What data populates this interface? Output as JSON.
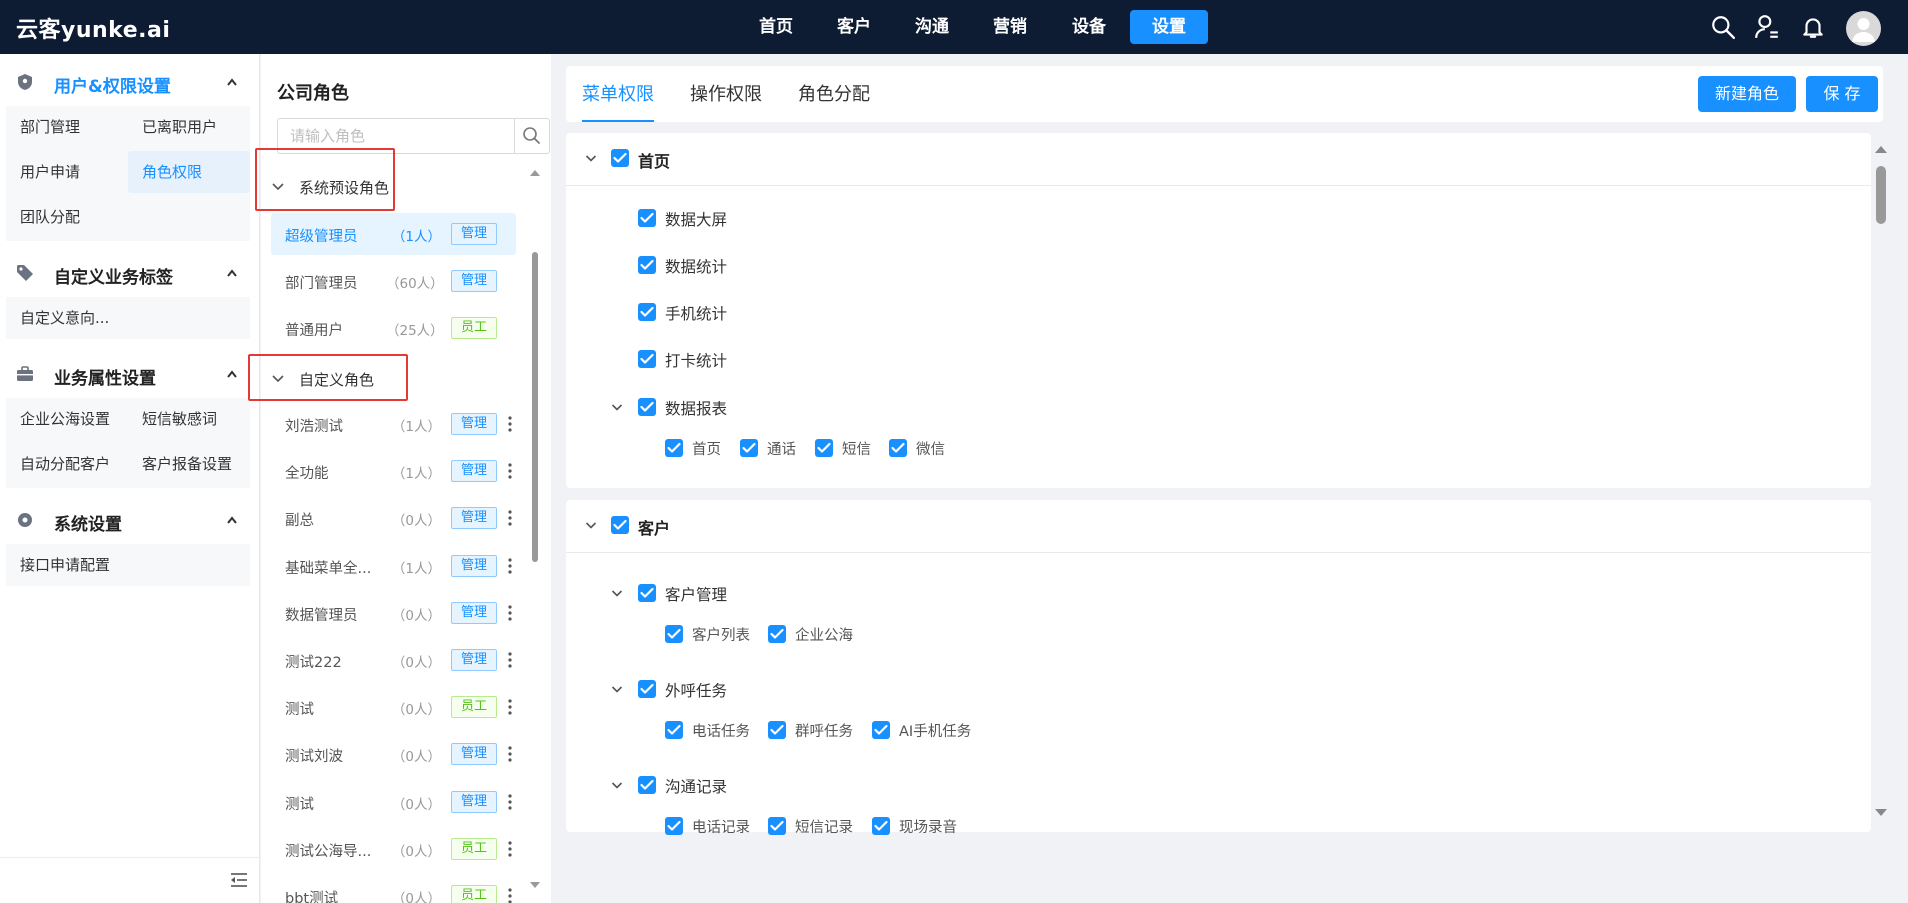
{
  "app": {
    "logo": "云客yunke.ai"
  },
  "topnav": {
    "items": [
      "首页",
      "客户",
      "沟通",
      "营销",
      "设备",
      "设置"
    ],
    "active_index": 5,
    "icons": [
      "search-icon",
      "user-settings-icon",
      "bell-icon",
      "avatar"
    ]
  },
  "sidebar": {
    "groups": [
      {
        "title": "用户&权限设置",
        "icon": "shield-icon",
        "active": true,
        "items": [
          "部门管理",
          "已离职用户",
          "用户申请",
          "角色权限",
          "团队分配"
        ],
        "active_item": "角色权限"
      },
      {
        "title": "自定义业务标签",
        "icon": "tag-icon",
        "items": [
          "自定义意向..."
        ]
      },
      {
        "title": "业务属性设置",
        "icon": "briefcase-icon",
        "items": [
          "企业公海设置",
          "短信敏感词",
          "自动分配客户",
          "客户报备设置"
        ]
      },
      {
        "title": "系统设置",
        "icon": "gear-icon",
        "items": [
          "接口申请配置"
        ]
      }
    ]
  },
  "roles": {
    "title": "公司角色",
    "search_placeholder": "请输入角色",
    "sections": [
      {
        "title": "系统预设角色",
        "items": [
          {
            "name": "超级管理员",
            "count": "（1人）",
            "tag": "管理",
            "active": true
          },
          {
            "name": "部门管理员",
            "count": "（60人）",
            "tag": "管理"
          },
          {
            "name": "普通用户",
            "count": "（25人）",
            "tag": "员工"
          }
        ]
      },
      {
        "title": "自定义角色",
        "items": [
          {
            "name": "刘浩测试",
            "count": "（1人）",
            "tag": "管理"
          },
          {
            "name": "全功能",
            "count": "（1人）",
            "tag": "管理"
          },
          {
            "name": "副总",
            "count": "（0人）",
            "tag": "管理"
          },
          {
            "name": "基础菜单全...",
            "count": "（1人）",
            "tag": "管理"
          },
          {
            "name": "数据管理员",
            "count": "（0人）",
            "tag": "管理"
          },
          {
            "name": "测试222",
            "count": "（0人）",
            "tag": "管理"
          },
          {
            "name": "测试",
            "count": "（0人）",
            "tag": "员工"
          },
          {
            "name": "测试刘波",
            "count": "（0人）",
            "tag": "管理"
          },
          {
            "name": "测试",
            "count": "（0人）",
            "tag": "管理"
          },
          {
            "name": "测试公海导...",
            "count": "（0人）",
            "tag": "员工"
          },
          {
            "name": "bbt测试",
            "count": "（0人）",
            "tag": "员工"
          }
        ]
      }
    ]
  },
  "main": {
    "tabs": [
      "菜单权限",
      "操作权限",
      "角色分配"
    ],
    "active_tab": "菜单权限",
    "buttons": {
      "new_role": "新建角色",
      "save": "保 存"
    },
    "cards": [
      {
        "title": "首页",
        "children": [
          {
            "label": "数据大屏"
          },
          {
            "label": "数据统计"
          },
          {
            "label": "手机统计"
          },
          {
            "label": "打卡统计"
          },
          {
            "label": "数据报表",
            "children": [
              "首页",
              "通话",
              "短信",
              "微信"
            ]
          }
        ]
      },
      {
        "title": "客户",
        "children": [
          {
            "label": "客户管理",
            "children": [
              "客户列表",
              "企业公海"
            ]
          },
          {
            "label": "外呼任务",
            "children": [
              "电话任务",
              "群呼任务",
              "AI手机任务"
            ]
          },
          {
            "label": "沟通记录",
            "children": [
              "电话记录",
              "短信记录",
              "现场录音"
            ]
          }
        ]
      }
    ]
  },
  "colors": {
    "topbar": "#0d1b33",
    "primary": "#1890ff",
    "employee_tag": "#52c41a",
    "highlight_box": "#e53935"
  }
}
